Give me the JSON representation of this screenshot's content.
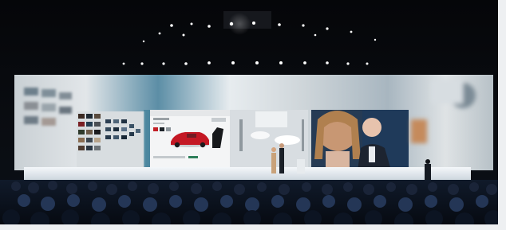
{
  "scene": {
    "description_free": true,
    "colors": {
      "hall": "#07090d",
      "screen_light": "#dfe4e8",
      "screen_mid": "#b9c6cf",
      "car_red": "#c41824",
      "audience": "#0b1220",
      "stage_glow": "#eef3f7"
    }
  }
}
